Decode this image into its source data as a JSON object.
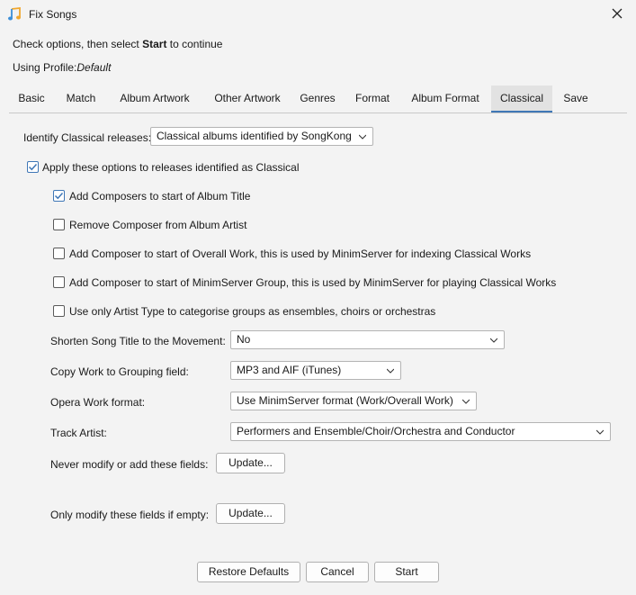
{
  "window": {
    "title": "Fix Songs",
    "icon": "music-note-icon"
  },
  "instruction": {
    "prefix": "Check options, then select ",
    "bold": "Start",
    "suffix": " to continue"
  },
  "profile": {
    "label": "Using Profile:",
    "value": "Default"
  },
  "tabs": [
    {
      "label": "Basic"
    },
    {
      "label": "Match"
    },
    {
      "label": "Album Artwork"
    },
    {
      "label": "Other Artwork"
    },
    {
      "label": "Genres"
    },
    {
      "label": "Format"
    },
    {
      "label": "Album Format"
    },
    {
      "label": "Classical"
    },
    {
      "label": "Save"
    }
  ],
  "active_tab": "Classical",
  "identify": {
    "label": "Identify Classical releases:",
    "value": "Classical albums identified by SongKong"
  },
  "apply_option": {
    "label": "Apply these options to releases identified as Classical",
    "checked": true
  },
  "options": [
    {
      "label": "Add Composers to start of Album Title",
      "checked": true
    },
    {
      "label": "Remove Composer from Album Artist",
      "checked": false
    },
    {
      "label": "Add Composer to start of Overall Work, this is used by MinimServer for indexing Classical Works",
      "checked": false
    },
    {
      "label": "Add Composer to start of MinimServer Group, this is used by MinimServer for playing Classical Works",
      "checked": false
    },
    {
      "label": "Use only Artist Type to categorise groups as ensembles, choirs or orchestras",
      "checked": false
    }
  ],
  "fields": {
    "shorten": {
      "label": "Shorten Song Title to the Movement:",
      "value": "No"
    },
    "copy_work": {
      "label": "Copy Work to Grouping field:",
      "value": "MP3 and AIF (iTunes)"
    },
    "opera": {
      "label": "Opera Work format:",
      "value": "Use MinimServer format (Work/Overall Work)"
    },
    "track_artist": {
      "label": "Track Artist:",
      "value": "Performers and Ensemble/Choir/Orchestra and Conductor"
    },
    "never_modify": {
      "label": "Never modify or add these fields:",
      "button": "Update..."
    },
    "only_modify": {
      "label": "Only modify these fields if empty:",
      "button": "Update..."
    }
  },
  "footer": {
    "restore": "Restore Defaults",
    "cancel": "Cancel",
    "start": "Start"
  },
  "colors": {
    "accent": "#3f77b6",
    "background": "#f3f3f3"
  }
}
